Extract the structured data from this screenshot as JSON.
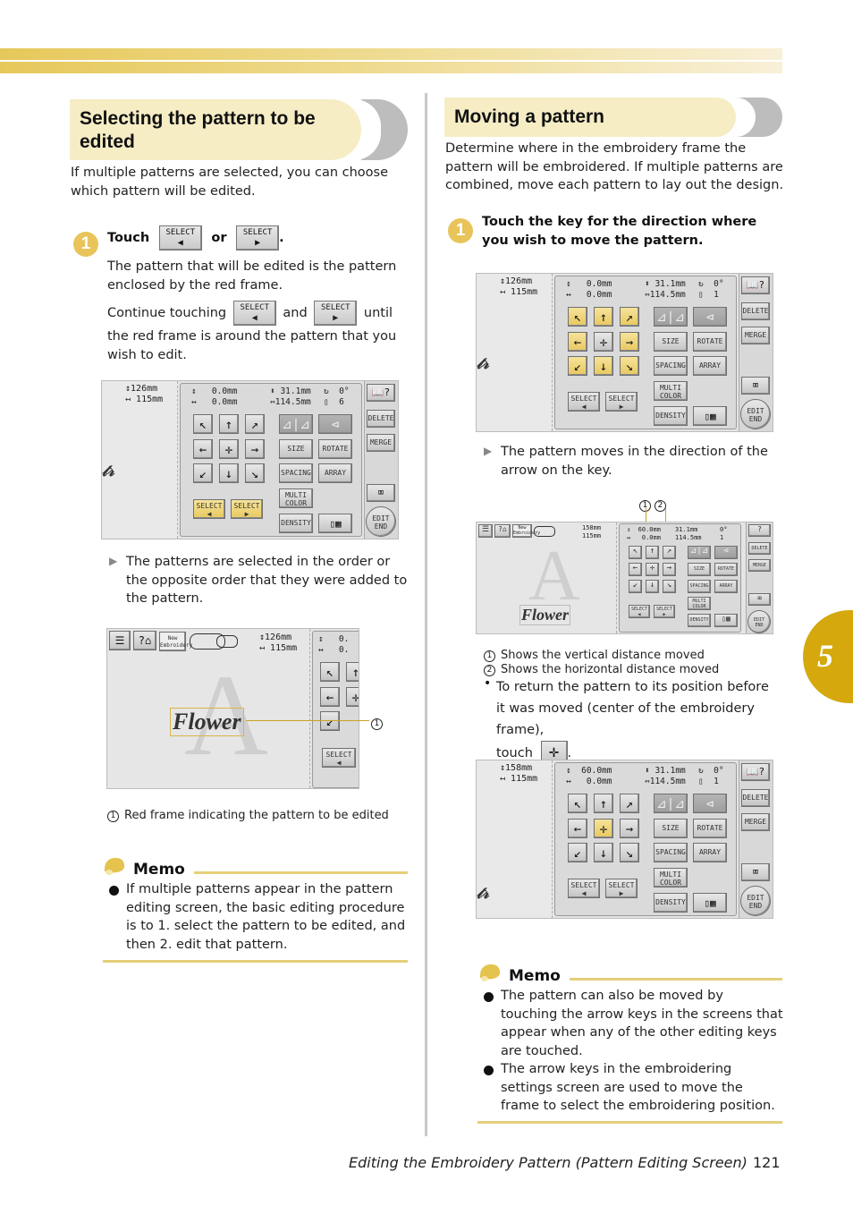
{
  "chapter_tab": "5",
  "left": {
    "title": "Selecting the pattern to be edited",
    "intro": "If multiple patterns are selected, you can choose which pattern will be edited.",
    "step": {
      "number": "1",
      "touch_label": "Touch",
      "or_label": "or",
      "period": ".",
      "desc1": "The pattern that will be edited is the pattern enclosed by the red frame.",
      "continue_pre": "Continue touching",
      "continue_and": "and",
      "continue_post": "until",
      "continue_rest": "the red frame is around the pattern that you wish to edit.",
      "result": "The patterns are selected in the order or the opposite order that they were added to the pattern."
    },
    "callout_1": "Red frame indicating the pattern to be edited",
    "memo": {
      "label": "Memo",
      "items": [
        "If multiple patterns appear in the pattern editing screen, the basic editing procedure is to 1. select the pattern to be edited, and then 2. edit that pattern."
      ]
    }
  },
  "right": {
    "title": "Moving a pattern",
    "intro": "Determine where in the embroidery frame the pattern will be embroidered. If multiple patterns are combined, move each pattern to lay out the design.",
    "step": {
      "number": "1",
      "text": "Touch the key for the direction where you wish to move the pattern.",
      "result": "The pattern moves in the direction of the arrow on the key."
    },
    "callouts": [
      "Shows the vertical distance moved",
      "Shows the horizontal distance moved"
    ],
    "return_note_1": "To return the pattern to its position before it was moved (center of the embroidery frame),",
    "return_note_2": "touch",
    "return_note_3": ".",
    "memo": {
      "label": "Memo",
      "items": [
        "The pattern can also be moved by touching the arrow keys in the screens that appear when any of the other editing keys are touched.",
        "The arrow keys in the embroidering settings screen are used to move the frame to select the embroidering position."
      ]
    }
  },
  "keys": {
    "select": "SELECT",
    "left_arrow": "◀",
    "right_arrow": "▶",
    "size": "SIZE",
    "rotate": "ROTATE",
    "spacing": "SPACING",
    "array": "ARRAY",
    "multi_color": "MULTI COLOR",
    "density": "DENSITY",
    "delete": "DELETE",
    "merge": "MERGE",
    "edit_end": "EDIT END",
    "new_embroidery": "New Embroidery"
  },
  "screens": {
    "s1": {
      "height": "126mm",
      "width": "115mm",
      "v": "0.0mm",
      "h": "0.0mm",
      "ph": "31.1mm",
      "pw": "114.5mm",
      "angle": "0°",
      "count": "6"
    },
    "s2": {
      "height": "126mm",
      "width": "115mm",
      "v": "0.0mm",
      "h": "0.0mm",
      "ph": "31.1mm",
      "pw": "114.5mm",
      "angle": "0°",
      "count": "1"
    },
    "s3": {
      "height": "158mm",
      "width": "115mm",
      "v": "60.0mm",
      "h": "0.0mm",
      "ph": "31.1mm",
      "pw": "114.5mm",
      "angle": "0°",
      "count": "1"
    },
    "s4": {
      "height": "158mm",
      "width": "115mm",
      "v": "60.0mm",
      "h": "0.0mm",
      "ph": "31.1mm",
      "pw": "114.5mm",
      "angle": "0°",
      "count": "1"
    },
    "flower_text": "Flower",
    "big_letter": "A",
    "height_full": "126mm",
    "width_full": "115mm"
  },
  "footer": {
    "title": "Editing the Embroidery Pattern (Pattern Editing Screen)",
    "page": "121"
  }
}
